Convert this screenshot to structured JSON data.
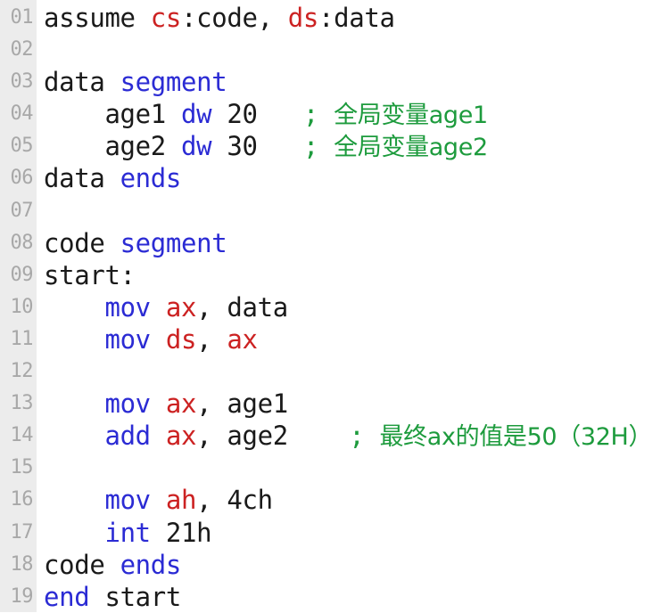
{
  "editor": {
    "background": "#ffffff",
    "gutter_background": "#ececec",
    "gutter_text_color": "#a8a8a8",
    "colors": {
      "plain": "#1a1a1a",
      "keyword": "#2b2bd4",
      "register": "#cc2222",
      "comment": "#1d9b3d"
    },
    "language": "assembly-8086",
    "lines": [
      {
        "number": "01",
        "tokens": [
          {
            "text": "assume ",
            "type": "plain"
          },
          {
            "text": "cs",
            "type": "register"
          },
          {
            "text": ":code, ",
            "type": "plain"
          },
          {
            "text": "ds",
            "type": "register"
          },
          {
            "text": ":data",
            "type": "plain"
          }
        ]
      },
      {
        "number": "02",
        "tokens": []
      },
      {
        "number": "03",
        "tokens": [
          {
            "text": "data ",
            "type": "plain"
          },
          {
            "text": "segment",
            "type": "keyword"
          }
        ]
      },
      {
        "number": "04",
        "tokens": [
          {
            "text": "    age1 ",
            "type": "plain"
          },
          {
            "text": "dw",
            "type": "keyword"
          },
          {
            "text": " 20   ",
            "type": "plain"
          },
          {
            "text": "; ",
            "type": "comment"
          },
          {
            "text": "全局变量age1",
            "type": "comment",
            "cjk": true
          }
        ]
      },
      {
        "number": "05",
        "tokens": [
          {
            "text": "    age2 ",
            "type": "plain"
          },
          {
            "text": "dw",
            "type": "keyword"
          },
          {
            "text": " 30   ",
            "type": "plain"
          },
          {
            "text": "; ",
            "type": "comment"
          },
          {
            "text": "全局变量age2",
            "type": "comment",
            "cjk": true
          }
        ]
      },
      {
        "number": "06",
        "tokens": [
          {
            "text": "data ",
            "type": "plain"
          },
          {
            "text": "ends",
            "type": "keyword"
          }
        ]
      },
      {
        "number": "07",
        "tokens": []
      },
      {
        "number": "08",
        "tokens": [
          {
            "text": "code ",
            "type": "plain"
          },
          {
            "text": "segment",
            "type": "keyword"
          }
        ]
      },
      {
        "number": "09",
        "tokens": [
          {
            "text": "start:",
            "type": "plain"
          }
        ]
      },
      {
        "number": "10",
        "tokens": [
          {
            "text": "    ",
            "type": "plain"
          },
          {
            "text": "mov",
            "type": "keyword"
          },
          {
            "text": " ",
            "type": "plain"
          },
          {
            "text": "ax",
            "type": "register"
          },
          {
            "text": ", data",
            "type": "plain"
          }
        ]
      },
      {
        "number": "11",
        "tokens": [
          {
            "text": "    ",
            "type": "plain"
          },
          {
            "text": "mov",
            "type": "keyword"
          },
          {
            "text": " ",
            "type": "plain"
          },
          {
            "text": "ds",
            "type": "register"
          },
          {
            "text": ", ",
            "type": "plain"
          },
          {
            "text": "ax",
            "type": "register"
          }
        ]
      },
      {
        "number": "12",
        "tokens": []
      },
      {
        "number": "13",
        "tokens": [
          {
            "text": "    ",
            "type": "plain"
          },
          {
            "text": "mov",
            "type": "keyword"
          },
          {
            "text": " ",
            "type": "plain"
          },
          {
            "text": "ax",
            "type": "register"
          },
          {
            "text": ", age1",
            "type": "plain"
          }
        ]
      },
      {
        "number": "14",
        "tokens": [
          {
            "text": "    ",
            "type": "plain"
          },
          {
            "text": "add",
            "type": "keyword"
          },
          {
            "text": " ",
            "type": "plain"
          },
          {
            "text": "ax",
            "type": "register"
          },
          {
            "text": ", age2    ",
            "type": "plain"
          },
          {
            "text": "; ",
            "type": "comment"
          },
          {
            "text": "最终ax的值是50（32H）",
            "type": "comment",
            "cjk": true
          }
        ]
      },
      {
        "number": "15",
        "tokens": []
      },
      {
        "number": "16",
        "tokens": [
          {
            "text": "    ",
            "type": "plain"
          },
          {
            "text": "mov",
            "type": "keyword"
          },
          {
            "text": " ",
            "type": "plain"
          },
          {
            "text": "ah",
            "type": "register"
          },
          {
            "text": ", 4ch",
            "type": "plain"
          }
        ]
      },
      {
        "number": "17",
        "tokens": [
          {
            "text": "    ",
            "type": "plain"
          },
          {
            "text": "int",
            "type": "keyword"
          },
          {
            "text": " 21h",
            "type": "plain"
          }
        ]
      },
      {
        "number": "18",
        "tokens": [
          {
            "text": "code ",
            "type": "plain"
          },
          {
            "text": "ends",
            "type": "keyword"
          }
        ]
      },
      {
        "number": "19",
        "tokens": [
          {
            "text": "end",
            "type": "keyword"
          },
          {
            "text": " start",
            "type": "plain"
          }
        ]
      }
    ]
  }
}
